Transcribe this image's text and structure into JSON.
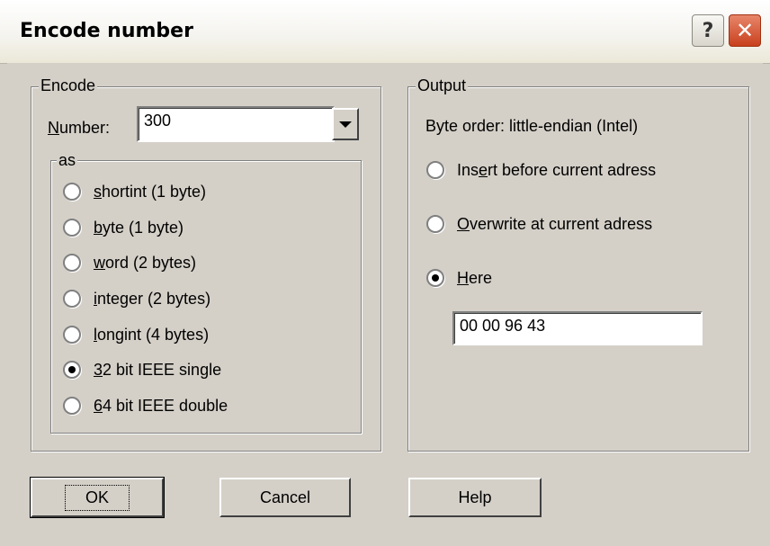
{
  "window": {
    "title": "Encode number",
    "help_glyph": "?",
    "close_glyph": "✕"
  },
  "encode": {
    "legend": "Encode",
    "number_label_mnemonic": "N",
    "number_label_rest": "umber:",
    "number_value": "300",
    "as_legend": "as",
    "options": [
      {
        "mnemonic": "s",
        "rest": "hortint (1 byte)",
        "checked": false
      },
      {
        "mnemonic": "b",
        "rest": "yte (1 byte)",
        "checked": false
      },
      {
        "mnemonic": "w",
        "rest": "ord (2 bytes)",
        "checked": false
      },
      {
        "mnemonic": "i",
        "rest": "nteger (2 bytes)",
        "checked": false
      },
      {
        "mnemonic": "l",
        "rest": "ongint (4 bytes)",
        "checked": false
      },
      {
        "mnemonic": "3",
        "rest": "2 bit IEEE single",
        "checked": true
      },
      {
        "mnemonic": "6",
        "rest": "4 bit IEEE double",
        "checked": false
      }
    ]
  },
  "output": {
    "legend": "Output",
    "byte_order": "Byte order: little-endian (Intel)",
    "insert_pre": "Ins",
    "insert_mn": "e",
    "insert_post": "rt before current adress",
    "overwrite_mn": "O",
    "overwrite_post": "verwrite at current adress",
    "here_mn": "H",
    "here_post": "ere",
    "selected": "here",
    "here_value": "00 00 96 43"
  },
  "buttons": {
    "ok": "OK",
    "cancel": "Cancel",
    "help": "Help"
  }
}
